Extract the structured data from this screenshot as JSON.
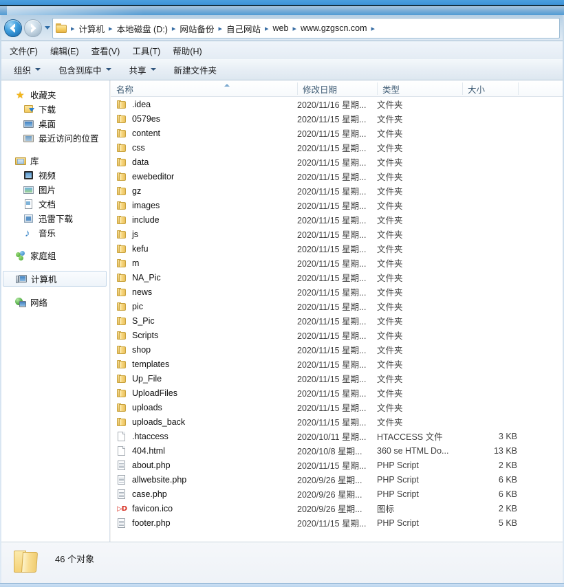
{
  "window": {
    "chrome": {
      "titlebar_color": "#3e93d8",
      "glass_color": "#7fb0d8"
    }
  },
  "navigation": {
    "back_label": "后退",
    "forward_label": "前进",
    "history_label": "最近浏览的位置",
    "breadcrumb": [
      "计算机",
      "本地磁盘 (D:)",
      "网站备份",
      "自己网站",
      "web",
      "www.gzgscn.com"
    ],
    "separator": "▸"
  },
  "menubar": {
    "items": [
      {
        "label": "文件(F)"
      },
      {
        "label": "编辑(E)"
      },
      {
        "label": "查看(V)"
      },
      {
        "label": "工具(T)"
      },
      {
        "label": "帮助(H)"
      }
    ]
  },
  "toolbar": {
    "items": [
      {
        "label": "组织",
        "caret": true
      },
      {
        "label": "包含到库中",
        "caret": true
      },
      {
        "label": "共享",
        "caret": true
      },
      {
        "label": "新建文件夹",
        "caret": false
      }
    ]
  },
  "sidebar": {
    "groups": [
      {
        "header": {
          "label": "收藏夹",
          "icon": "star-icon"
        },
        "items": [
          {
            "label": "下载",
            "icon": "downloads-icon"
          },
          {
            "label": "桌面",
            "icon": "desktop-icon"
          },
          {
            "label": "最近访问的位置",
            "icon": "recent-places-icon"
          }
        ]
      },
      {
        "header": {
          "label": "库",
          "icon": "library-icon"
        },
        "items": [
          {
            "label": "视频",
            "icon": "video-icon"
          },
          {
            "label": "图片",
            "icon": "picture-icon"
          },
          {
            "label": "文档",
            "icon": "document-icon"
          },
          {
            "label": "迅雷下载",
            "icon": "xunlei-download-icon"
          },
          {
            "label": "音乐",
            "icon": "music-icon"
          }
        ]
      },
      {
        "header": {
          "label": "家庭组",
          "icon": "homegroup-icon"
        },
        "items": []
      },
      {
        "header": {
          "label": "计算机",
          "icon": "computer-icon",
          "selected": true
        },
        "items": []
      },
      {
        "header": {
          "label": "网络",
          "icon": "network-icon"
        },
        "items": []
      }
    ]
  },
  "filelist": {
    "columns": [
      {
        "key": "name",
        "label": "名称",
        "sorted": "asc"
      },
      {
        "key": "date",
        "label": "修改日期"
      },
      {
        "key": "type",
        "label": "类型"
      },
      {
        "key": "size",
        "label": "大小"
      }
    ],
    "rows": [
      {
        "name": ".idea",
        "date": "2020/11/16 星期...",
        "type": "文件夹",
        "size": "",
        "icon": "folder-icon"
      },
      {
        "name": "0579es",
        "date": "2020/11/15 星期...",
        "type": "文件夹",
        "size": "",
        "icon": "folder-icon"
      },
      {
        "name": "content",
        "date": "2020/11/15 星期...",
        "type": "文件夹",
        "size": "",
        "icon": "folder-icon"
      },
      {
        "name": "css",
        "date": "2020/11/15 星期...",
        "type": "文件夹",
        "size": "",
        "icon": "folder-icon"
      },
      {
        "name": "data",
        "date": "2020/11/15 星期...",
        "type": "文件夹",
        "size": "",
        "icon": "folder-icon"
      },
      {
        "name": "ewebeditor",
        "date": "2020/11/15 星期...",
        "type": "文件夹",
        "size": "",
        "icon": "folder-icon"
      },
      {
        "name": "gz",
        "date": "2020/11/15 星期...",
        "type": "文件夹",
        "size": "",
        "icon": "folder-icon"
      },
      {
        "name": "images",
        "date": "2020/11/15 星期...",
        "type": "文件夹",
        "size": "",
        "icon": "folder-icon"
      },
      {
        "name": "include",
        "date": "2020/11/15 星期...",
        "type": "文件夹",
        "size": "",
        "icon": "folder-icon"
      },
      {
        "name": "js",
        "date": "2020/11/15 星期...",
        "type": "文件夹",
        "size": "",
        "icon": "folder-icon"
      },
      {
        "name": "kefu",
        "date": "2020/11/15 星期...",
        "type": "文件夹",
        "size": "",
        "icon": "folder-icon"
      },
      {
        "name": "m",
        "date": "2020/11/15 星期...",
        "type": "文件夹",
        "size": "",
        "icon": "folder-icon"
      },
      {
        "name": "NA_Pic",
        "date": "2020/11/15 星期...",
        "type": "文件夹",
        "size": "",
        "icon": "folder-icon"
      },
      {
        "name": "news",
        "date": "2020/11/15 星期...",
        "type": "文件夹",
        "size": "",
        "icon": "folder-icon"
      },
      {
        "name": "pic",
        "date": "2020/11/15 星期...",
        "type": "文件夹",
        "size": "",
        "icon": "folder-icon"
      },
      {
        "name": "S_Pic",
        "date": "2020/11/15 星期...",
        "type": "文件夹",
        "size": "",
        "icon": "folder-icon"
      },
      {
        "name": "Scripts",
        "date": "2020/11/15 星期...",
        "type": "文件夹",
        "size": "",
        "icon": "folder-icon"
      },
      {
        "name": "shop",
        "date": "2020/11/15 星期...",
        "type": "文件夹",
        "size": "",
        "icon": "folder-icon"
      },
      {
        "name": "templates",
        "date": "2020/11/15 星期...",
        "type": "文件夹",
        "size": "",
        "icon": "folder-icon"
      },
      {
        "name": "Up_File",
        "date": "2020/11/15 星期...",
        "type": "文件夹",
        "size": "",
        "icon": "folder-icon"
      },
      {
        "name": "UploadFiles",
        "date": "2020/11/15 星期...",
        "type": "文件夹",
        "size": "",
        "icon": "folder-icon"
      },
      {
        "name": "uploads",
        "date": "2020/11/15 星期...",
        "type": "文件夹",
        "size": "",
        "icon": "folder-icon"
      },
      {
        "name": "uploads_back",
        "date": "2020/11/15 星期...",
        "type": "文件夹",
        "size": "",
        "icon": "folder-icon"
      },
      {
        "name": ".htaccess",
        "date": "2020/10/11 星期...",
        "type": "HTACCESS 文件",
        "size": "3 KB",
        "icon": "page-icon"
      },
      {
        "name": "404.html",
        "date": "2020/10/8 星期...",
        "type": "360 se HTML Do...",
        "size": "13 KB",
        "icon": "page-icon"
      },
      {
        "name": "about.php",
        "date": "2020/11/15 星期...",
        "type": "PHP Script",
        "size": "2 KB",
        "icon": "script-icon"
      },
      {
        "name": "allwebsite.php",
        "date": "2020/9/26 星期...",
        "type": "PHP Script",
        "size": "6 KB",
        "icon": "script-icon"
      },
      {
        "name": "case.php",
        "date": "2020/9/26 星期...",
        "type": "PHP Script",
        "size": "6 KB",
        "icon": "script-icon"
      },
      {
        "name": "favicon.ico",
        "date": "2020/9/26 星期...",
        "type": "图标",
        "size": "2 KB",
        "icon": "favicon-icon"
      },
      {
        "name": "footer.php",
        "date": "2020/11/15 星期...",
        "type": "PHP Script",
        "size": "5 KB",
        "icon": "script-icon"
      }
    ]
  },
  "statusbar": {
    "item_count_text": "46 个对象",
    "icon": "folder-large-icon"
  }
}
